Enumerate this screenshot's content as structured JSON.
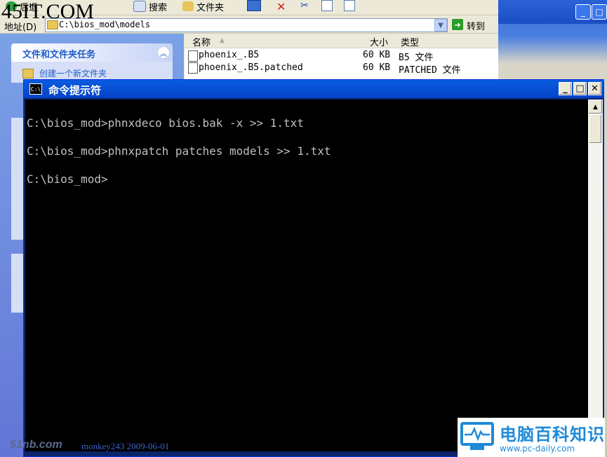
{
  "watermark": {
    "top_left": "45IT.COM",
    "bottom_left_site": "51nb.com",
    "bottom_left_author": "monkey243  2009-06-01",
    "brand_name": "电脑百科知识",
    "brand_url": "www.pc-daily.com"
  },
  "explorer": {
    "toolbar": {
      "back_label": "后退",
      "search_label": "搜索",
      "folders_label": "文件夹"
    },
    "address": {
      "label": "地址(D)",
      "value": "C:\\bios_mod\\models",
      "go_label": "转到"
    },
    "task_pane": {
      "title": "文件和文件夹任务",
      "link": "创建一个新文件夹"
    },
    "columns": {
      "name": "名称",
      "size": "大小",
      "type": "类型"
    },
    "files": [
      {
        "name": "phoenix_.B5",
        "size": "60 KB",
        "type": "B5 文件"
      },
      {
        "name": "phoenix_.B5.patched",
        "size": "60 KB",
        "type": "PATCHED 文件"
      }
    ]
  },
  "cmd": {
    "title": "命令提示符",
    "icon_text": "C:\\",
    "lines": [
      "C:\\bios_mod>phnxdeco bios.bak -x >> 1.txt",
      "C:\\bios_mod>phnxpatch patches models >> 1.txt",
      "C:\\bios_mod>"
    ],
    "buttons": {
      "minimize": "_",
      "maximize": "□",
      "close": "✕"
    }
  },
  "colors": {
    "cmd_text": "#c0c0c0",
    "cmd_background": "#000000",
    "title_bar": "#0a5be0",
    "task_pane": "#7ba2e7"
  }
}
